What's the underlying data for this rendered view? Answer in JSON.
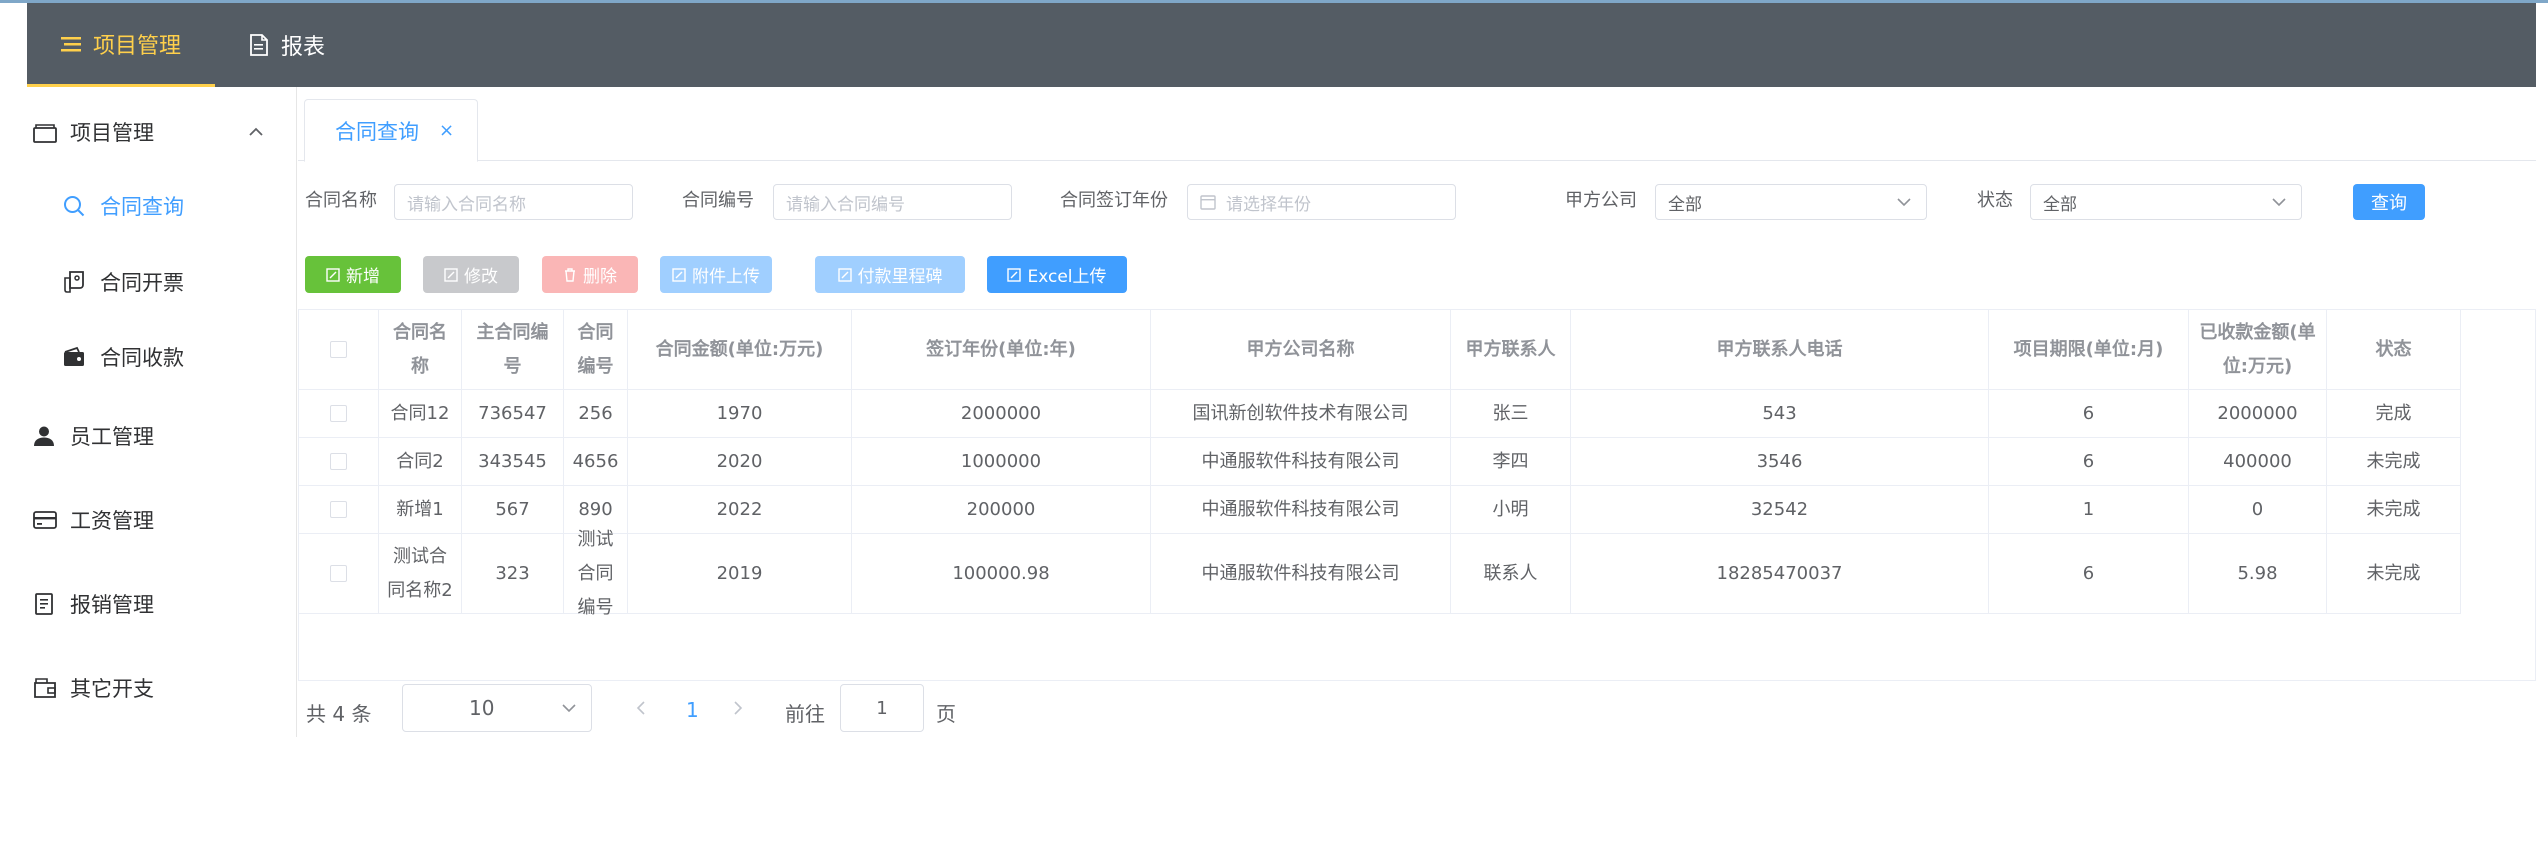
{
  "topnav": {
    "items": [
      {
        "label": "项目管理",
        "icon": "menu-lines-icon",
        "active": true
      },
      {
        "label": "报表",
        "icon": "document-icon",
        "active": false
      }
    ],
    "active_color": "#ffd04b",
    "bg_color": "#545c64"
  },
  "sidebar": {
    "group": {
      "label": "项目管理",
      "icon": "wallet-icon",
      "expanded": true
    },
    "sub_items": [
      {
        "label": "合同查询",
        "icon": "search-icon",
        "active": true
      },
      {
        "label": "合同开票",
        "icon": "ticket-icon",
        "active": false
      },
      {
        "label": "合同收款",
        "icon": "purse-icon",
        "active": false
      }
    ],
    "items": [
      {
        "label": "员工管理",
        "icon": "user-icon"
      },
      {
        "label": "工资管理",
        "icon": "credit-card-icon"
      },
      {
        "label": "报销管理",
        "icon": "notebook-icon"
      },
      {
        "label": "其它开支",
        "icon": "wallet-outline-icon"
      }
    ]
  },
  "tabs": [
    {
      "label": "合同查询",
      "close": "×"
    }
  ],
  "filters": {
    "contract_name": {
      "label": "合同名称",
      "placeholder": "请输入合同名称"
    },
    "contract_no": {
      "label": "合同编号",
      "placeholder": "请输入合同编号"
    },
    "sign_year": {
      "label": "合同签订年份",
      "placeholder": "请选择年份"
    },
    "party_a": {
      "label": "甲方公司",
      "value": "全部"
    },
    "status": {
      "label": "状态",
      "value": "全部"
    },
    "query_button": "查询"
  },
  "toolbar": {
    "add": "新增",
    "edit": "修改",
    "delete": "删除",
    "attach_upload": "附件上传",
    "milestone": "付款里程碑",
    "excel_upload": "Excel上传"
  },
  "colors": {
    "primary": "#409eff",
    "success": "#67c23a",
    "disabled_gray": "#c8c9cc",
    "disabled_red": "#fab6b6",
    "disabled_blue": "#a0cfff"
  },
  "table": {
    "columns": [
      "合同名称",
      "主合同编号",
      "合同编号",
      "合同金额(单位:万元)",
      "签订年份(单位:年)",
      "甲方公司名称",
      "甲方联系人",
      "甲方联系人电话",
      "项目期限(单位:月)",
      "已收款金额(单位:万元)",
      "状态"
    ],
    "rows": [
      [
        "合同12",
        "736547",
        "256",
        "1970",
        "2000000",
        "国讯新创软件技术有限公司",
        "张三",
        "543",
        "6",
        "2000000",
        "完成"
      ],
      [
        "合同2",
        "343545",
        "4656",
        "2020",
        "1000000",
        "中通服软件科技有限公司",
        "李四",
        "3546",
        "6",
        "400000",
        "未完成"
      ],
      [
        "新增1",
        "567",
        "890",
        "2022",
        "200000",
        "中通服软件科技有限公司",
        "小明",
        "32542",
        "1",
        "0",
        "未完成"
      ],
      [
        "测试合同名称2",
        "323",
        "测试合同编号",
        "2019",
        "100000.98",
        "中通服软件科技有限公司",
        "联系人",
        "18285470037",
        "6",
        "5.98",
        "未完成"
      ]
    ]
  },
  "pagination": {
    "total_text": "共 4 条",
    "page_size": "10",
    "current_page": "1",
    "goto_label": "前往",
    "goto_value": "1",
    "page_unit": "页"
  }
}
